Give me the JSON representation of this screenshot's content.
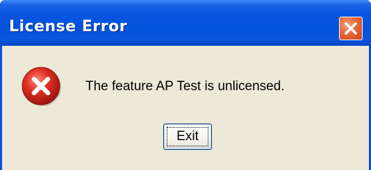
{
  "dialog": {
    "title": "License Error",
    "message": "The feature AP Test is unlicensed.",
    "exit_label": "Exit",
    "icons": {
      "close": "close-icon",
      "error": "error-icon"
    },
    "colors": {
      "titlebar": "#0a55e0",
      "client": "#ece9d8",
      "close_button": "#e5683b",
      "error_icon": "#d4271f"
    }
  }
}
